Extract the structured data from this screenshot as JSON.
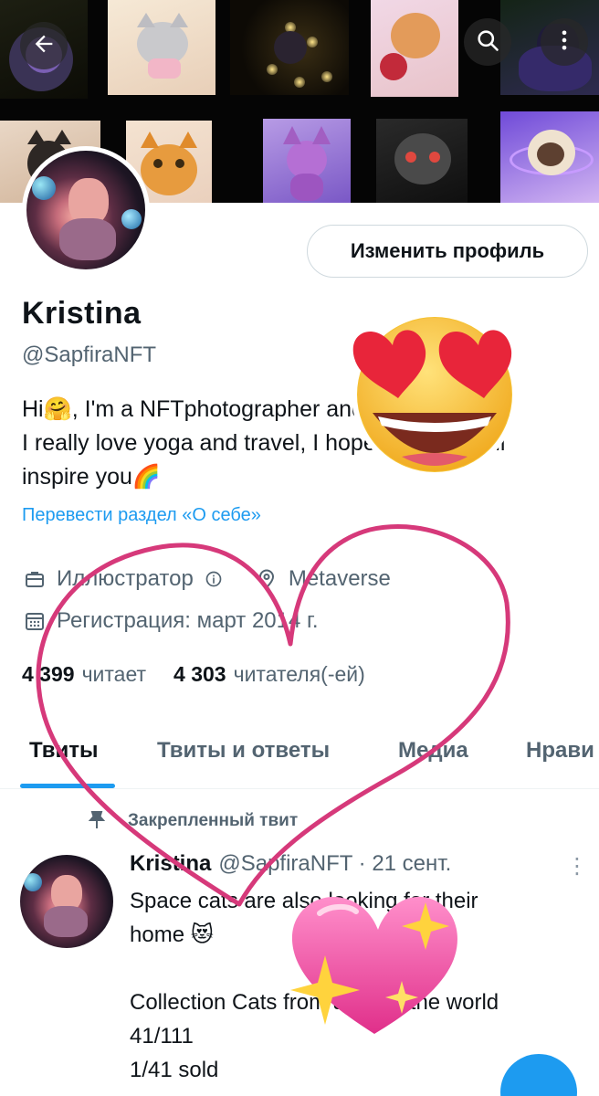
{
  "header": {
    "back_icon": "arrow-left-icon",
    "search_icon": "search-icon",
    "more_icon": "more-vertical-icon"
  },
  "profile": {
    "edit_button": "Изменить профиль",
    "name": "Kristina",
    "handle": "@SapfiraNFT",
    "bio": "Hi🤗, I'm a NFTphotographer and digital artist.\nI really love yoga and travel, I hope my work will\ninspire you🌈",
    "translate_link": "Перевести раздел «О себе»",
    "profession": "Иллюстратор",
    "location": "Metaverse",
    "joined": "Регистрация: март 2014 г.",
    "following_count": "4 399",
    "following_label": "читает",
    "followers_count": "4 303",
    "followers_label": "читателя(-ей)"
  },
  "tabs": [
    {
      "label": "Твиты",
      "active": true
    },
    {
      "label": "Твиты и ответы",
      "active": false
    },
    {
      "label": "Медиа",
      "active": false
    },
    {
      "label": "Нрави",
      "active": false
    }
  ],
  "tweet": {
    "pinned_label": "Закрепленный твит",
    "author": "Kristina",
    "handle_date": "@SapfiraNFT · 21 сент.",
    "body": "Space cats are also looking for their\nhome 😻\n\nCollection Cats from all over the world\n41/111\n1/41 sold"
  },
  "colors": {
    "accent": "#1d9bf0",
    "secondary_text": "#536471",
    "heart_outline": "#d6397a"
  },
  "stickers": [
    "heart-eyes-emoji-sticker",
    "drawn-heart-outline",
    "sparkling-heart-emoji-sticker"
  ]
}
